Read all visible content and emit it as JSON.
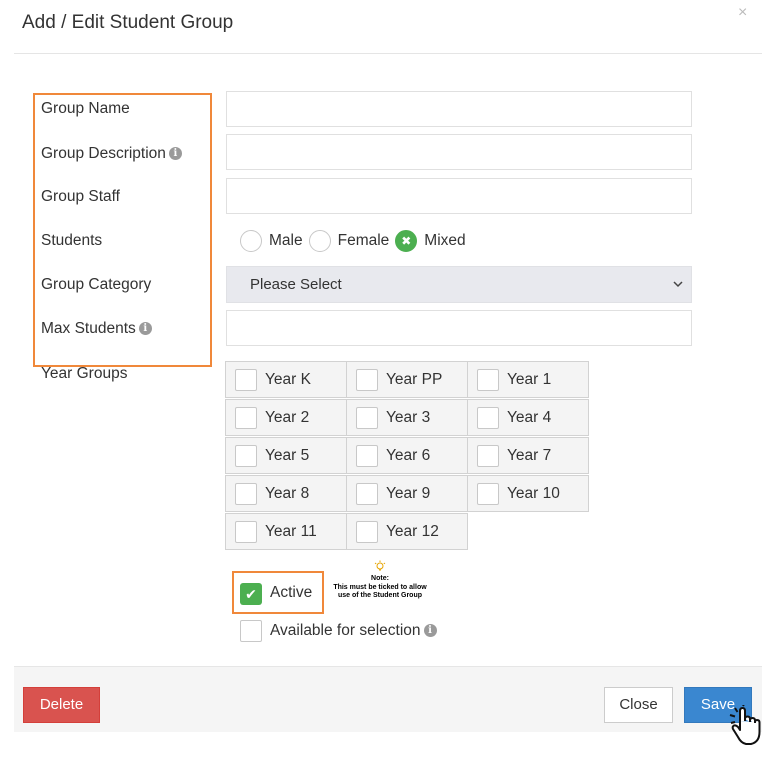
{
  "modal": {
    "title": "Add / Edit Student Group",
    "close_symbol": "×"
  },
  "labels": {
    "group_name": "Group Name",
    "group_description": "Group Description",
    "group_staff": "Group Staff",
    "students": "Students",
    "group_category": "Group Category",
    "max_students": "Max Students",
    "year_groups": "Year Groups"
  },
  "inputs": {
    "group_name": "",
    "group_description": "",
    "group_staff": "",
    "max_students": ""
  },
  "students_options": [
    {
      "label": "Male",
      "checked": false
    },
    {
      "label": "Female",
      "checked": false
    },
    {
      "label": "Mixed",
      "checked": true
    }
  ],
  "group_category": {
    "selected": "Please Select"
  },
  "year_groups": [
    [
      "Year K",
      "Year PP",
      "Year 1"
    ],
    [
      "Year 2",
      "Year 3",
      "Year 4"
    ],
    [
      "Year 5",
      "Year 6",
      "Year 7"
    ],
    [
      "Year 8",
      "Year 9",
      "Year 10"
    ],
    [
      "Year 11",
      "Year 12"
    ]
  ],
  "active": {
    "label": "Active",
    "checked": true
  },
  "note": {
    "title": "Note:",
    "text": "This must be ticked to allow use of the Student Group"
  },
  "available": {
    "label": "Available for selection",
    "checked": false
  },
  "footer": {
    "delete": "Delete",
    "close": "Close",
    "save": "Save"
  },
  "colors": {
    "accent_orange": "#f0883a",
    "checked_green": "#4caf50",
    "danger": "#d9534f",
    "primary": "#3a87d0"
  },
  "icons": {
    "info": "info-circle-icon",
    "check": "check-icon",
    "x_mark": "x-mark-icon",
    "chevron": "chevron-down-icon",
    "bulb": "lightbulb-icon",
    "hand": "hand-pointer-icon"
  }
}
